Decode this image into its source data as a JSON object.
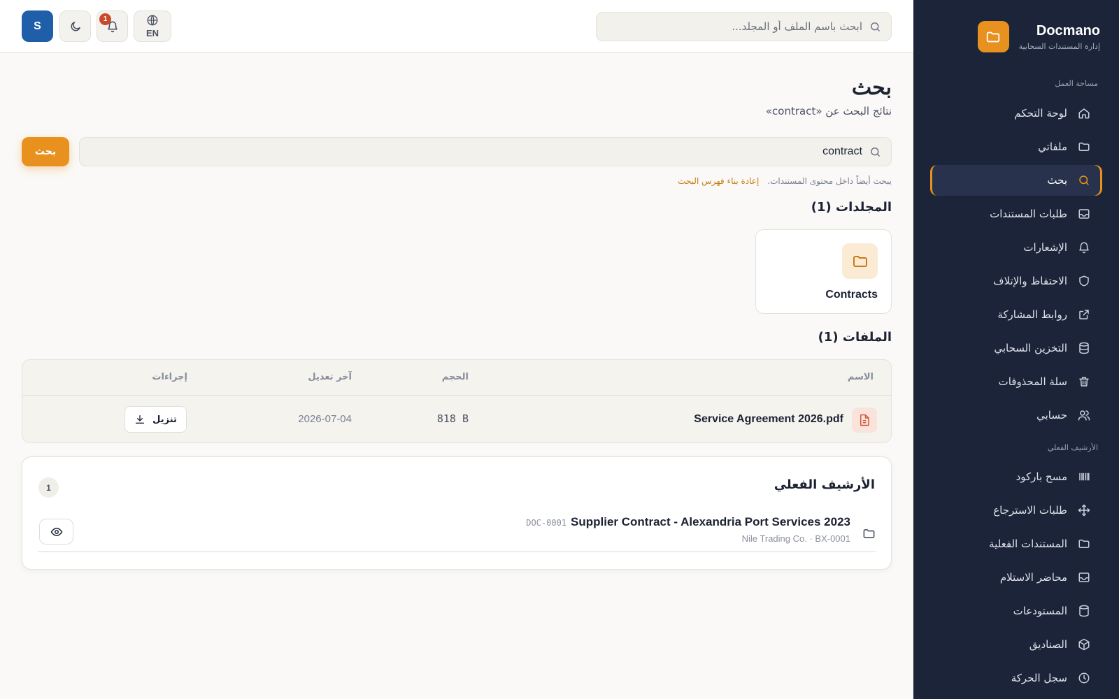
{
  "app": {
    "name": "Docmano",
    "tagline": "إدارة المستندات السحابية",
    "accent_color": "#e8911f",
    "sidebar_color": "#1b2438"
  },
  "sidebar": {
    "workspace_label": "مساحة العمل",
    "workspace_items": [
      {
        "label": "لوحة التحكم",
        "icon": "home-icon"
      },
      {
        "label": "ملفاتي",
        "icon": "folder-icon"
      },
      {
        "label": "بحث",
        "icon": "search-icon",
        "active": true
      },
      {
        "label": "طلبات المستندات",
        "icon": "inbox-icon"
      },
      {
        "label": "الإشعارات",
        "icon": "bell-icon"
      },
      {
        "label": "الاحتفاظ والإتلاف",
        "icon": "shield-icon"
      },
      {
        "label": "روابط المشاركة",
        "icon": "external-link-icon"
      },
      {
        "label": "التخزين السحابي",
        "icon": "database-icon"
      },
      {
        "label": "سلة المحذوفات",
        "icon": "trash-icon"
      },
      {
        "label": "حسابي",
        "icon": "users-icon"
      }
    ],
    "archive_label": "الأرشيف الفعلي",
    "archive_items": [
      {
        "label": "مسح باركود",
        "icon": "barcode-icon"
      },
      {
        "label": "طلبات الاسترجاع",
        "icon": "move-icon"
      },
      {
        "label": "المستندات الفعلية",
        "icon": "folder-icon"
      },
      {
        "label": "محاضر الاستلام",
        "icon": "inbox-icon"
      },
      {
        "label": "المستودعات",
        "icon": "database-icon"
      },
      {
        "label": "الصناديق",
        "icon": "box-icon"
      },
      {
        "label": "سجل الحركة",
        "icon": "clock-icon"
      }
    ]
  },
  "topbar": {
    "search_placeholder": "ابحث باسم الملف أو المجلد...",
    "language": "EN",
    "notification_count": "1",
    "user_initial": "S"
  },
  "page": {
    "title": "بحث",
    "subtitle": "نتائج البحث عن «contract»",
    "query": "contract",
    "search_button": "بحث",
    "hint": "يبحث أيضاً داخل محتوى المستندات.",
    "rebuild_link": "إعادة بناء فهرس البحث"
  },
  "folders": {
    "heading": "المجلدات (1)",
    "items": [
      {
        "name": "Contracts"
      }
    ]
  },
  "files": {
    "heading": "الملفات (1)",
    "columns": {
      "name": "الاسم",
      "size": "الحجم",
      "modified": "آخر تعديل",
      "actions": "إجراءات"
    },
    "rows": [
      {
        "name": "Service Agreement 2026.pdf",
        "size": "818 B",
        "modified": "2026-07-04",
        "action": "تنزيل"
      }
    ]
  },
  "physical_archive": {
    "title": "الأرشيف الفعلي",
    "count": "1",
    "items": [
      {
        "code": "DOC-0001",
        "name": "Supplier Contract - Alexandria Port Services 2023",
        "meta": "Nile Trading Co. · BX-0001"
      }
    ]
  }
}
